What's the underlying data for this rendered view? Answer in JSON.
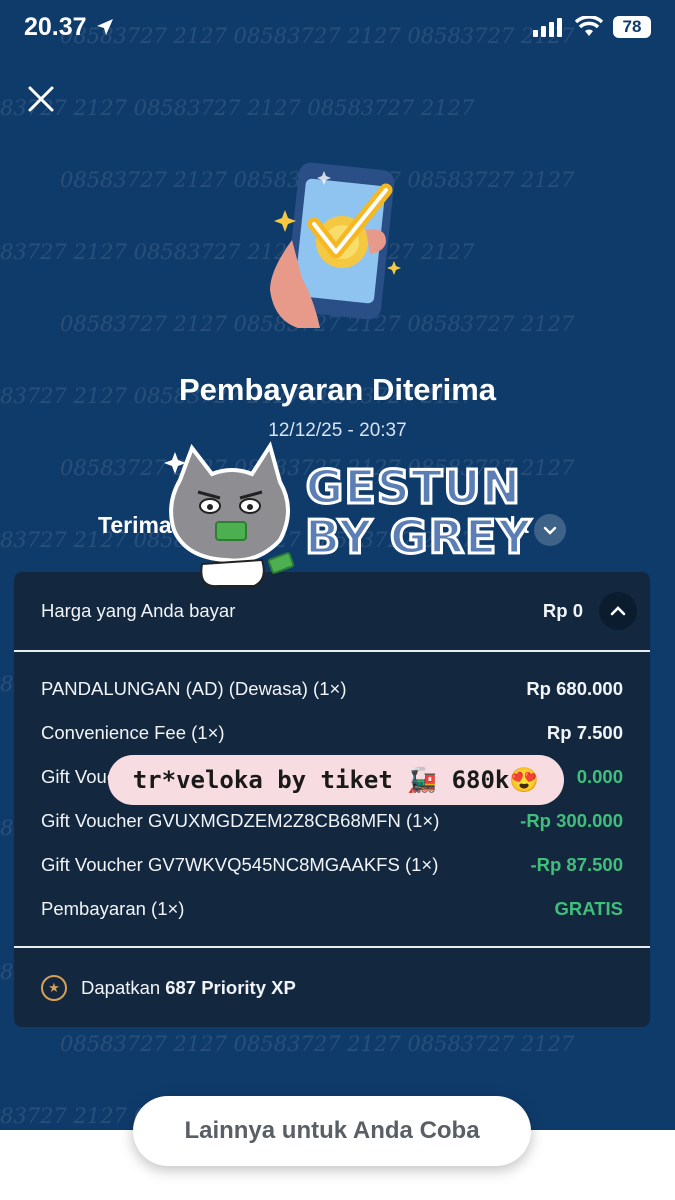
{
  "status_bar": {
    "time": "20.37",
    "battery": "78"
  },
  "watermark": {
    "text": "08583727 2127"
  },
  "header": {
    "close_icon": "close-icon"
  },
  "receipt": {
    "title": "Pembayaran Diterima",
    "datetime": "12/12/25 - 20:37",
    "thanks_text": "Terima",
    "thanks_suffix": "da"
  },
  "overlay": {
    "gestun_line1": "GESTUN",
    "gestun_line2": "BY GREY",
    "banner_text": "tr*veloka by tiket 🚂 680k😍"
  },
  "card": {
    "summary_label": "Harga yang Anda bayar",
    "summary_value": "Rp 0",
    "items": [
      {
        "label": "PANDALUNGAN (AD) (Dewasa) (1×)",
        "value": "Rp 680.000",
        "green": false
      },
      {
        "label": "Convenience Fee (1×)",
        "value": "Rp 7.500",
        "green": false
      },
      {
        "label": "Gift Vouc",
        "value": "0.000",
        "green": true
      },
      {
        "label": "Gift Voucher GVUXMGDZEM2Z8CB68MFN (1×)",
        "value": "-Rp 300.000",
        "green": true
      },
      {
        "label": "Gift Voucher GV7WKVQ545NC8MGAAKFS (1×)",
        "value": "-Rp 87.500",
        "green": true
      },
      {
        "label": "Pembayaran (1×)",
        "value": "GRATIS",
        "green": true
      }
    ],
    "xp_prefix": "Dapatkan",
    "xp_value": "687 Priority XP"
  },
  "footer": {
    "button_label": "Lainnya untuk Anda Coba"
  },
  "colors": {
    "background": "#0f3b6b",
    "card": "#13283f",
    "green": "#3fbf7a",
    "banner": "#f7dde1"
  }
}
